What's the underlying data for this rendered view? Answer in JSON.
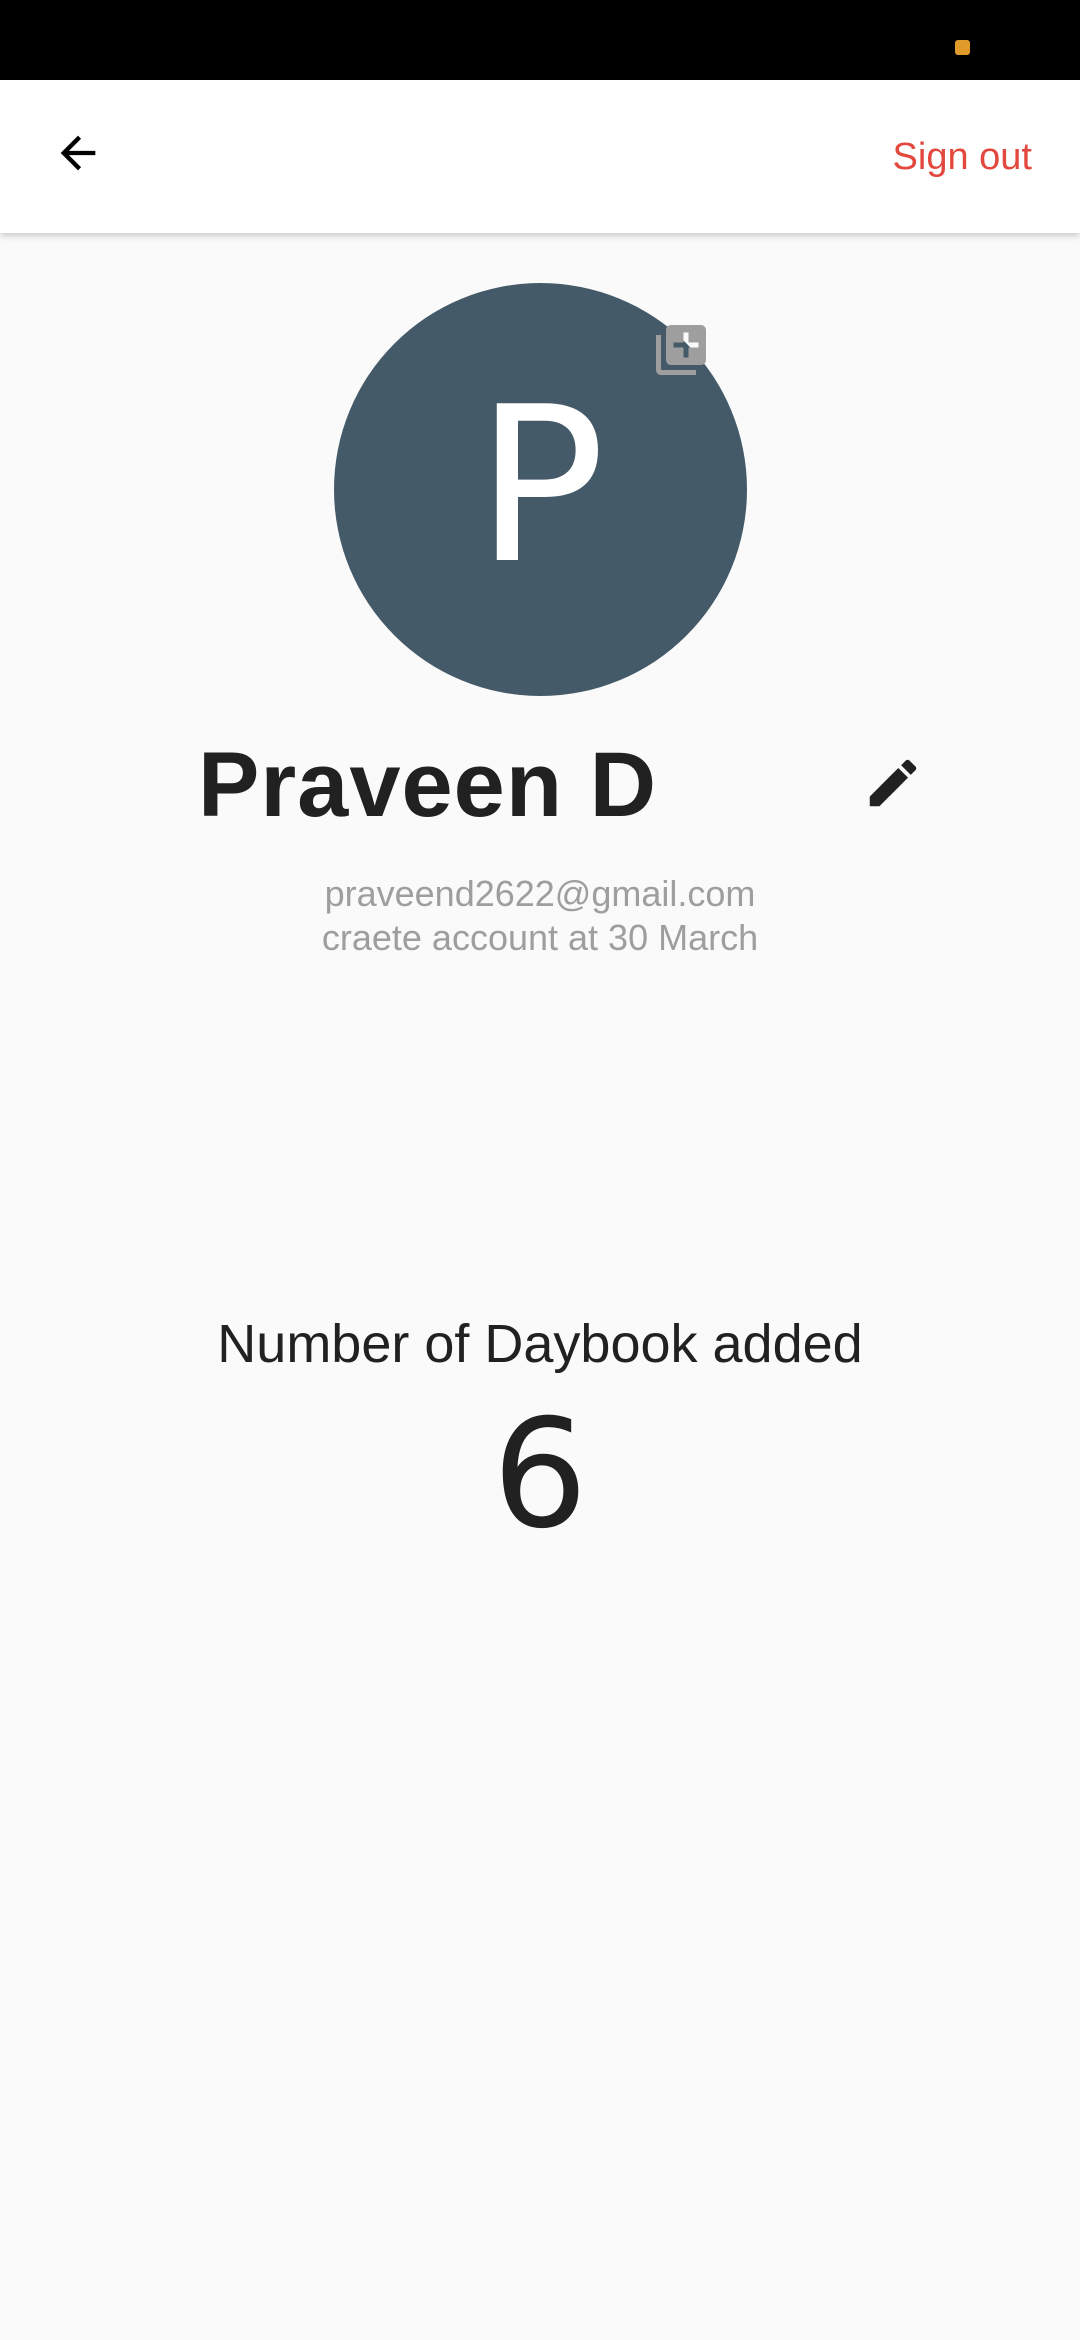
{
  "status_bar": {
    "battery_icon": "battery-icon",
    "background": "#000000"
  },
  "app_bar": {
    "back_icon": "arrow-back-icon",
    "signout_label": "Sign out",
    "signout_color": "#e2483d"
  },
  "profile": {
    "avatar_letter": "P",
    "avatar_color": "#455a68",
    "add_photo_icon": "add-photo-library-icon",
    "name": "Praveen D",
    "edit_icon": "pencil-icon",
    "email": "praveend2622@gmail.com",
    "created": "craete account at 30 March"
  },
  "stats": {
    "label": "Number of Daybook added",
    "value": "6"
  }
}
